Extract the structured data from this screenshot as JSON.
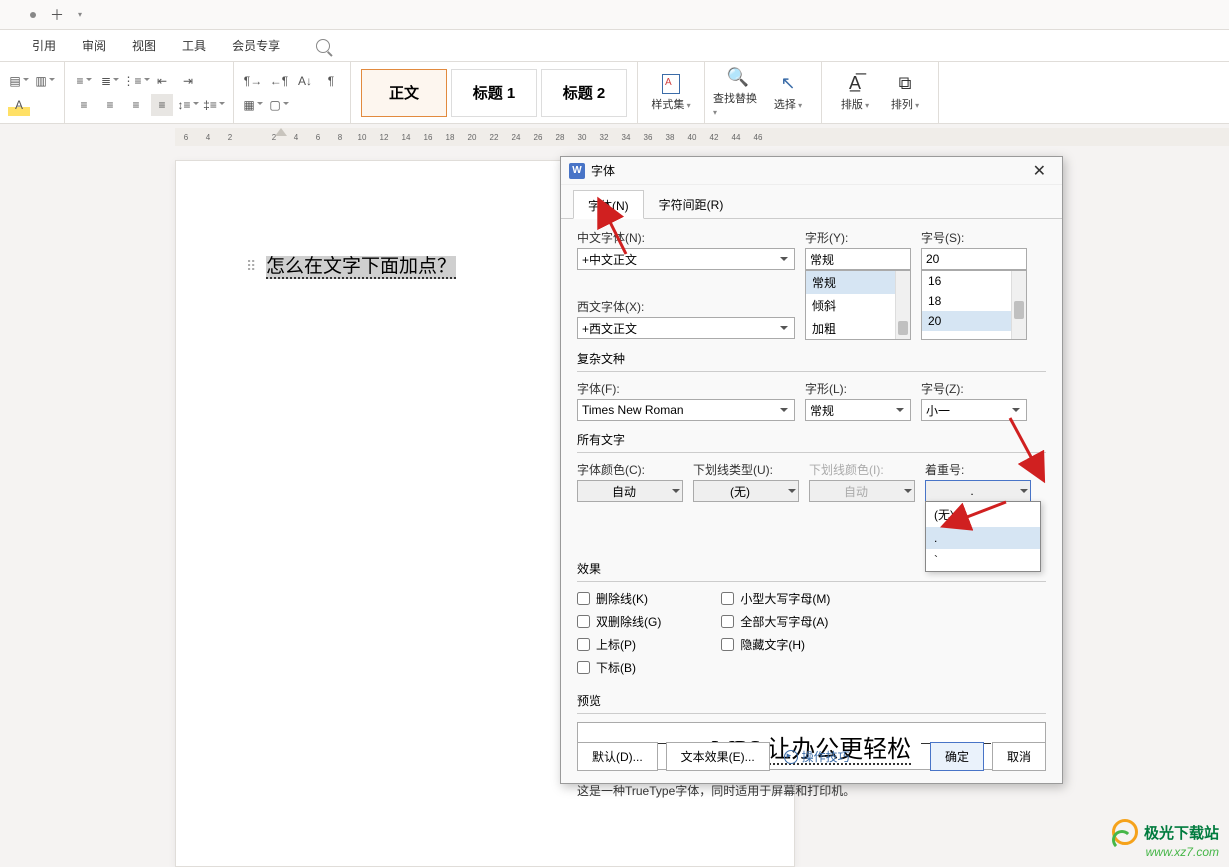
{
  "tabbar": {
    "plus": "＋"
  },
  "menu": {
    "items": [
      "引用",
      "审阅",
      "视图",
      "工具",
      "会员专享"
    ]
  },
  "ribbon": {
    "styles": {
      "normal": "正文",
      "h1": "标题 1",
      "h2": "标题 2"
    },
    "styleset": "样式集",
    "findreplace": "查找替换",
    "select": "选择",
    "layout": "排版",
    "arrange": "排列"
  },
  "ruler": [
    "6",
    "4",
    "2",
    "",
    "2",
    "4",
    "6",
    "8",
    "10",
    "12",
    "14",
    "16",
    "18",
    "20",
    "22",
    "24",
    "26",
    "28",
    "30",
    "32",
    "34",
    "36",
    "38",
    "40",
    "42",
    "44",
    "46"
  ],
  "document": {
    "text": "怎么在文字下面加点？"
  },
  "dialog": {
    "title": "字体",
    "tabs": {
      "font": "字体(N)",
      "spacing": "字符间距(R)"
    },
    "cn_font_label": "中文字体(N):",
    "cn_font_value": "+中文正文",
    "west_font_label": "西文字体(X):",
    "west_font_value": "+西文正文",
    "style_label": "字形(Y):",
    "style_value": "常规",
    "style_options": [
      "常规",
      "倾斜",
      "加粗"
    ],
    "size_label": "字号(S):",
    "size_value": "20",
    "size_options": [
      "16",
      "18",
      "20"
    ],
    "complex_section": "复杂文种",
    "complex_font_label": "字体(F):",
    "complex_font_value": "Times New Roman",
    "complex_style_label": "字形(L):",
    "complex_style_value": "常规",
    "complex_size_label": "字号(Z):",
    "complex_size_value": "小一",
    "alltext_section": "所有文字",
    "font_color_label": "字体颜色(C):",
    "font_color_value": "自动",
    "underline_label": "下划线类型(U):",
    "underline_value": "(无)",
    "underline_color_label": "下划线颜色(I):",
    "underline_color_value": "自动",
    "emphasis_label": "着重号:",
    "emphasis_value": ".",
    "emphasis_options": [
      "(无)",
      ".",
      "`"
    ],
    "effects_section": "效果",
    "effects_left": [
      "删除线(K)",
      "双删除线(G)",
      "上标(P)",
      "下标(B)"
    ],
    "effects_right": [
      "小型大写字母(M)",
      "全部大写字母(A)",
      "隐藏文字(H)"
    ],
    "preview_section": "预览",
    "preview_text": "WPS 让办公更轻松",
    "truetype_note": "这是一种TrueType字体，同时适用于屏幕和打印机。",
    "footer": {
      "default": "默认(D)...",
      "text_effect": "文本效果(E)...",
      "tips": "操作技巧",
      "ok": "确定",
      "cancel": "取消"
    }
  },
  "watermark": {
    "name": "极光下载站",
    "url": "www.xz7.com"
  }
}
